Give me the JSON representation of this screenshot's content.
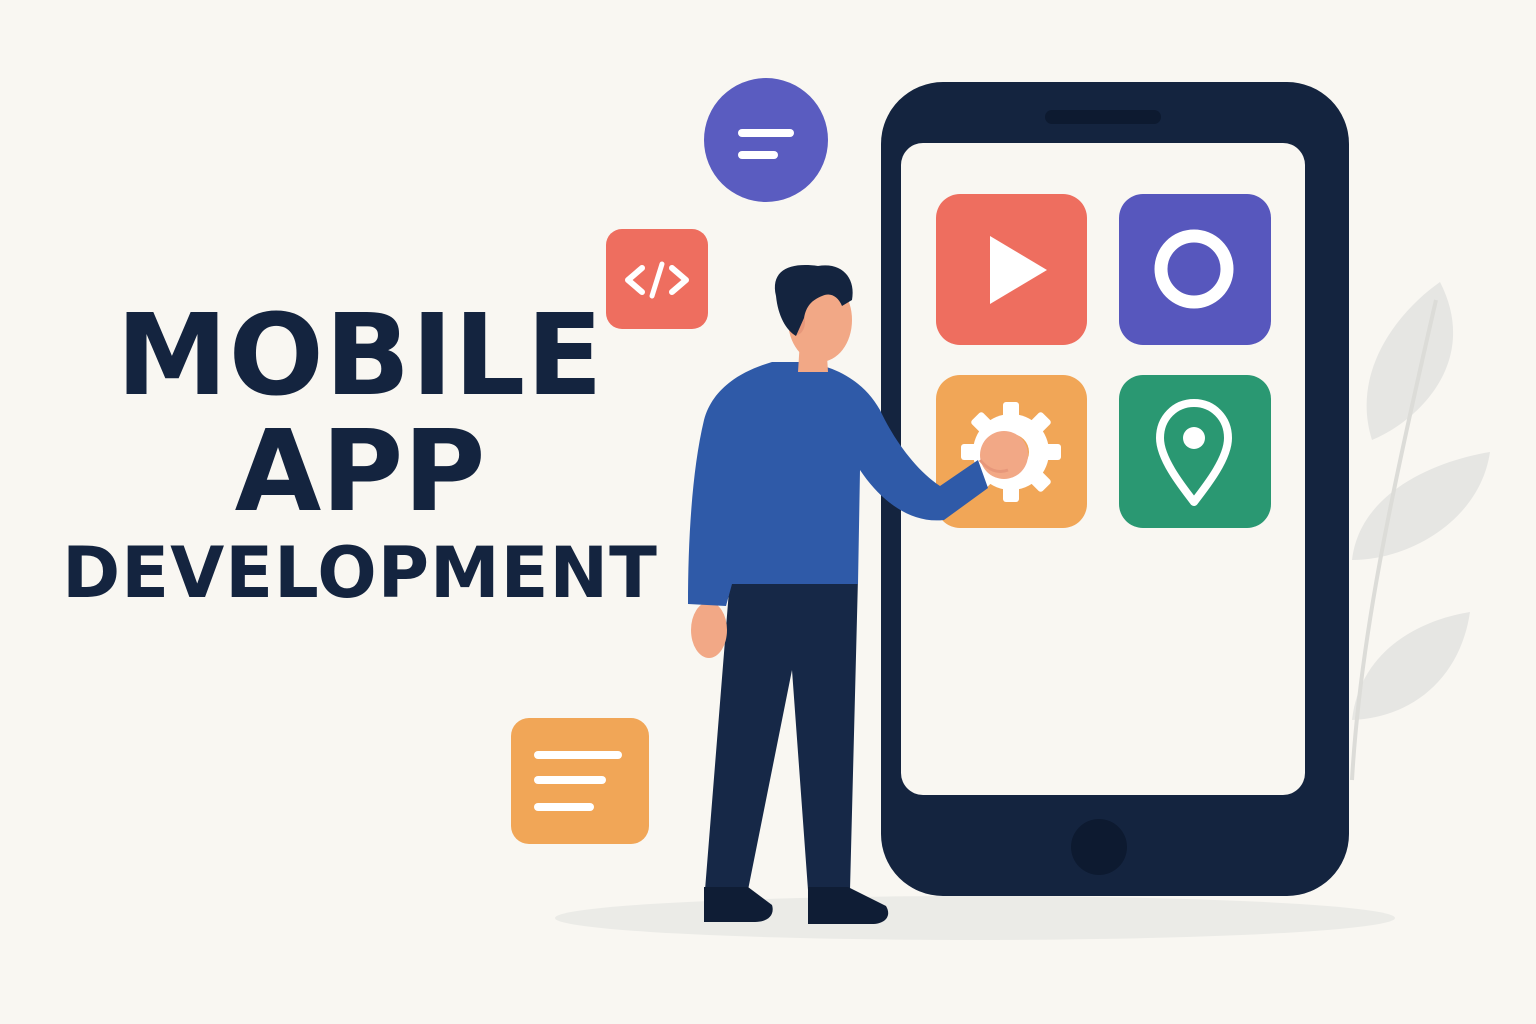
{
  "headline": {
    "line1": "MOBILE",
    "line2": "APP",
    "line3": "DEVELOPMENT"
  },
  "colors": {
    "background": "#f9f7f2",
    "navy": "#14243f",
    "coral": "#ee6e5f",
    "indigo": "#5757bd",
    "orange": "#f1a657",
    "green": "#2a9872",
    "shirt": "#2f5aa8",
    "leaf": "#e6e6e3"
  },
  "icons": {
    "floating": [
      "menu-bubble-icon",
      "code-icon",
      "document-lines-icon"
    ],
    "app_tiles": [
      "play-icon",
      "circle-record-icon",
      "gear-icon",
      "location-pin-icon"
    ]
  }
}
